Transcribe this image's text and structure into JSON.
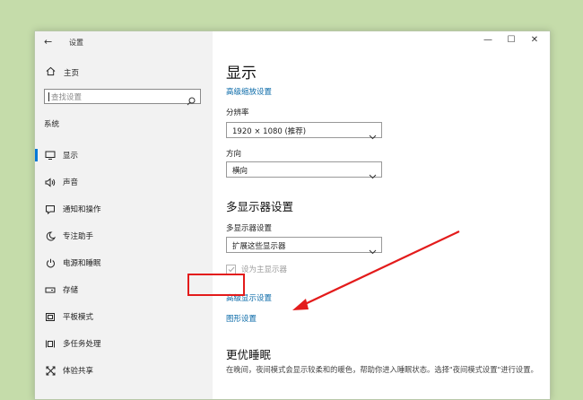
{
  "colors": {
    "background": "#c5dcaa",
    "accent": "#0078d7",
    "link": "#0a6aa8",
    "annotation": "#e31b1b"
  },
  "titlebar": {
    "back_icon": "back-arrow-icon",
    "title": "设置",
    "minimize": "—",
    "maximize": "☐",
    "close": "✕"
  },
  "sidebar": {
    "home_label": "主页",
    "search_placeholder": "查找设置",
    "section_label": "系统",
    "items": [
      {
        "icon": "monitor-icon",
        "label": "显示",
        "selected": true
      },
      {
        "icon": "speaker-icon",
        "label": "声音",
        "selected": false
      },
      {
        "icon": "notification-icon",
        "label": "通知和操作",
        "selected": false
      },
      {
        "icon": "moon-icon",
        "label": "专注助手",
        "selected": false
      },
      {
        "icon": "power-icon",
        "label": "电源和睡眠",
        "selected": false
      },
      {
        "icon": "storage-icon",
        "label": "存储",
        "selected": false
      },
      {
        "icon": "tablet-icon",
        "label": "平板模式",
        "selected": false
      },
      {
        "icon": "multitask-icon",
        "label": "多任务处理",
        "selected": false
      },
      {
        "icon": "share-icon",
        "label": "体验共享",
        "selected": false
      }
    ]
  },
  "main": {
    "title": "显示",
    "advanced_scaling_link": "高级缩放设置",
    "resolution_label": "分辨率",
    "resolution_value": "1920 × 1080 (推荐)",
    "orientation_label": "方向",
    "orientation_value": "横向",
    "multi_display_heading": "多显示器设置",
    "multi_display_label": "多显示器设置",
    "multi_display_value": "扩展这些显示器",
    "main_display_checkbox": "设为主显示器",
    "advanced_display_link": "高级显示设置",
    "graphics_settings_link": "图形设置",
    "sleep_heading": "更优睡眠",
    "sleep_text": "在晚间，夜间模式会显示较柔和的暖色，帮助你进入睡眠状态。选择\"夜间模式设置\"进行设置。"
  }
}
